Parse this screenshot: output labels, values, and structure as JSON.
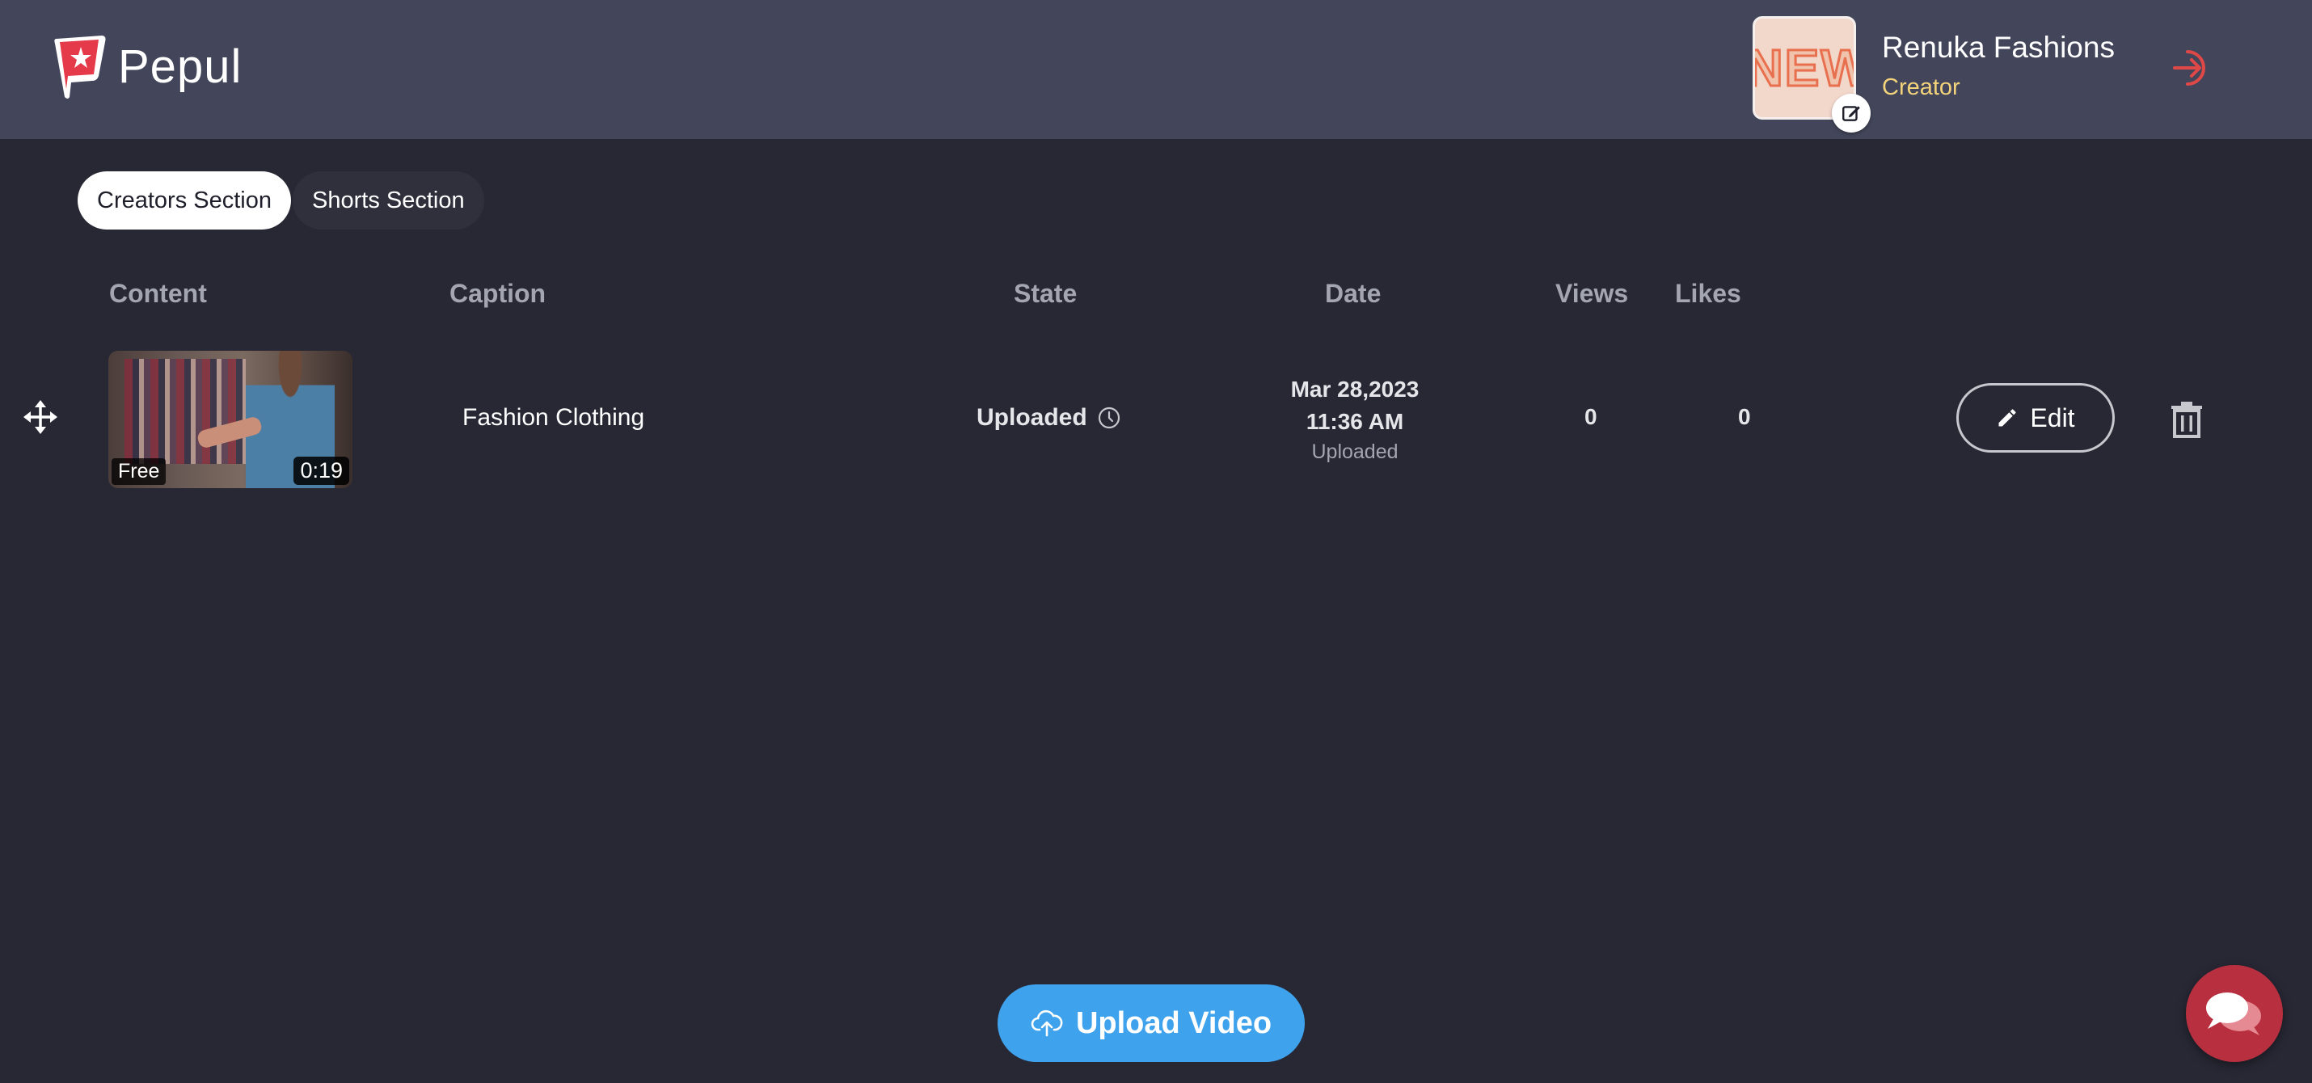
{
  "header": {
    "logo_text": "Pepul",
    "profile": {
      "thumb_text": "NEW",
      "name": "Renuka Fashions",
      "role": "Creator"
    }
  },
  "tabs": [
    {
      "label": "Creators Section",
      "active": true
    },
    {
      "label": "Shorts Section",
      "active": false
    }
  ],
  "table": {
    "columns": [
      "Content",
      "Caption",
      "State",
      "Date",
      "Views",
      "Likes"
    ],
    "rows": [
      {
        "thumb_badge": "Free",
        "duration": "0:19",
        "caption": "Fashion Clothing",
        "state": "Uploaded",
        "date": "Mar 28,2023",
        "time": "11:36 AM",
        "date_status": "Uploaded",
        "views": "0",
        "likes": "0",
        "edit_label": "Edit"
      }
    ]
  },
  "upload_label": "Upload Video",
  "colors": {
    "header_bg": "#43465a",
    "page_bg": "#272834",
    "accent_blue": "#3ea2ec",
    "role_yellow": "#f3d47b",
    "logout_red": "#e04848",
    "chat_red": "#b8303f"
  },
  "icons": [
    "pepul-logo-icon",
    "edit-badge-icon",
    "logout-icon",
    "move-icon",
    "clock-icon",
    "pencil-icon",
    "trash-icon",
    "cloud-upload-icon",
    "chat-icon"
  ]
}
